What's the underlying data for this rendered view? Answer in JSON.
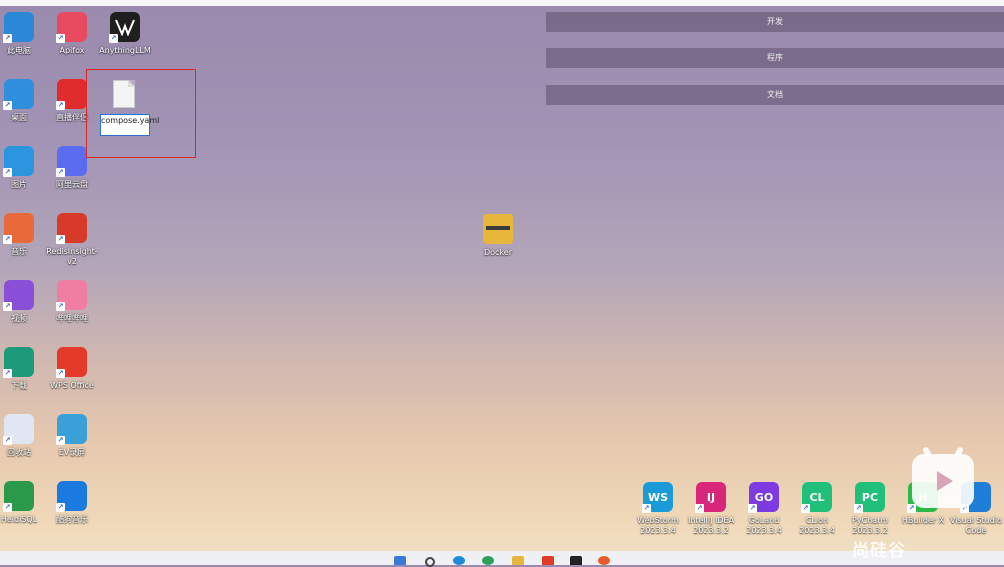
{
  "desktop": {
    "col1": [
      {
        "label": "此电脑",
        "icon": "monitor-icon",
        "color": "#2b88d8"
      },
      {
        "label": "桌面",
        "icon": "folder-desktop-icon",
        "color": "#2f8fdc"
      },
      {
        "label": "图片",
        "icon": "pictures-icon",
        "color": "#2b95e0"
      },
      {
        "label": "音乐",
        "icon": "music-icon",
        "color": "#e86a3a"
      },
      {
        "label": "视频",
        "icon": "video-icon",
        "color": "#8a4fd8"
      },
      {
        "label": "下载",
        "icon": "download-icon",
        "color": "#1c9a7a"
      },
      {
        "label": "回收站",
        "icon": "recycle-bin-icon",
        "color": "#dfe8f2"
      },
      {
        "label": "HeidiSQL",
        "icon": "heidisql-icon",
        "color": "#2a9a4a"
      }
    ],
    "col2": [
      {
        "label": "Apifox",
        "icon": "apifox-icon",
        "color": "#e84a5f"
      },
      {
        "label": "直播伴侣",
        "icon": "live-companion-icon",
        "color": "#e02c2c"
      },
      {
        "label": "阿里云盘",
        "icon": "aliyun-drive-icon",
        "color": "#5b6cf0"
      },
      {
        "label": "RedisInsight-v2",
        "icon": "redisinsight-icon",
        "color": "#d83a2a"
      },
      {
        "label": "哔哩哔哩",
        "icon": "bilibili-icon",
        "color": "#f07ea3"
      },
      {
        "label": "WPS Office",
        "icon": "wps-icon",
        "color": "#e43a2a"
      },
      {
        "label": "EV录屏",
        "icon": "ev-recorder-icon",
        "color": "#3aa0d8"
      },
      {
        "label": "酷狗音乐",
        "icon": "kugou-icon",
        "color": "#1a7ae0"
      }
    ],
    "col3": [
      {
        "label": "AnythingLLM",
        "icon": "anythingllm-icon",
        "color": "#1f1f1f"
      }
    ],
    "rename": {
      "value": "compose.yaml",
      "icon": "file-icon"
    },
    "docker_folder": {
      "label": "Docker",
      "icon": "folder-icon",
      "color": "#e8b63a"
    },
    "groups": [
      "开发",
      "程序",
      "文档"
    ],
    "dock": [
      {
        "abbr": "WS",
        "label": "WebStorm 2023.3.4",
        "icon": "webstorm-icon",
        "color": "#1a9bd8"
      },
      {
        "abbr": "IJ",
        "label": "IntelliJ IDEA 2023.3.2",
        "icon": "intellij-icon",
        "color": "#d8267a"
      },
      {
        "abbr": "GO",
        "label": "GoLand 2023.3.4",
        "icon": "goland-icon",
        "color": "#7c3ae0"
      },
      {
        "abbr": "CL",
        "label": "CLion 2023.3.4",
        "icon": "clion-icon",
        "color": "#21c07a"
      },
      {
        "abbr": "PC",
        "label": "PyCharm 2023.3.2",
        "icon": "pycharm-icon",
        "color": "#21c07a"
      },
      {
        "abbr": "H",
        "label": "HBuilder X",
        "icon": "hbuilder-icon",
        "color": "#2fb84a"
      },
      {
        "abbr": "",
        "label": "Visual Studio Code",
        "icon": "vscode-icon",
        "color": "#1f7fd8"
      }
    ]
  },
  "taskbar": {
    "icons": [
      "windows-icon",
      "search-icon",
      "edge-icon",
      "chrome-icon",
      "explorer-icon",
      "wps-icon",
      "terminal-icon",
      "app-icon"
    ]
  },
  "watermark": "尚硅谷"
}
